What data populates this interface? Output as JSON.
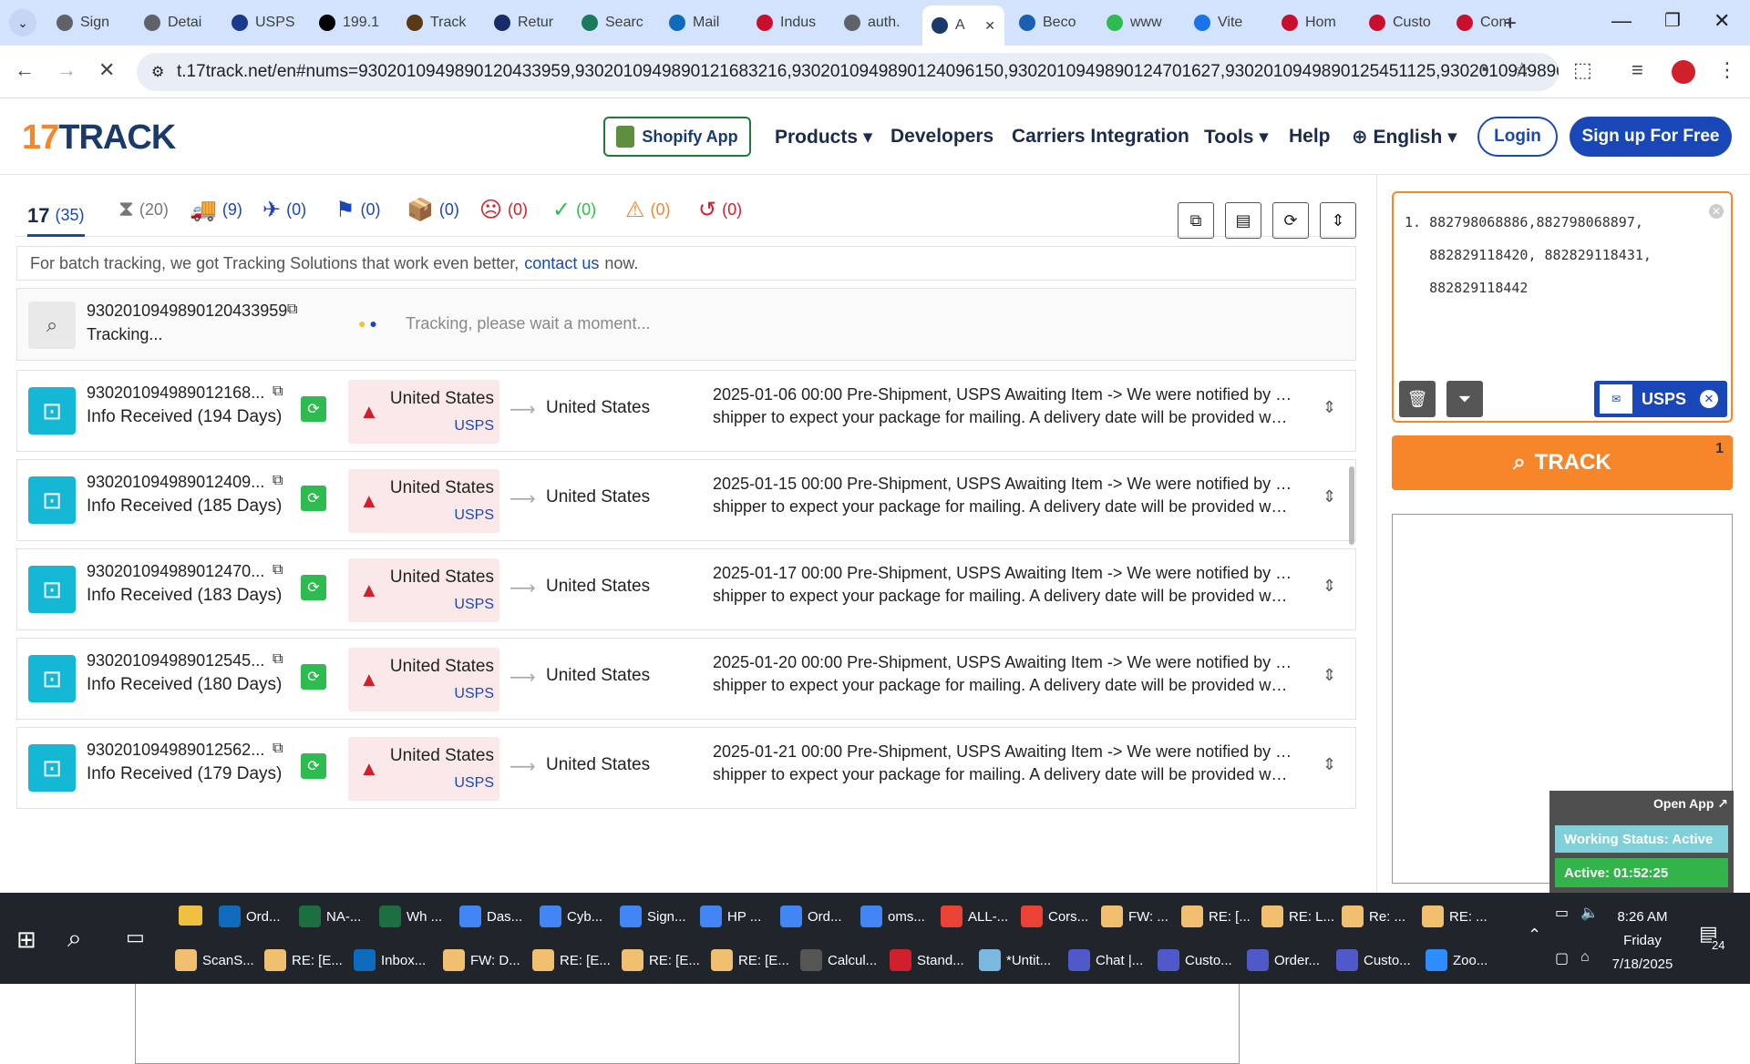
{
  "browser": {
    "tabs": [
      {
        "label": "Sign",
        "color": "#5f6368"
      },
      {
        "label": "Detai",
        "color": "#5f6368"
      },
      {
        "label": "USPS",
        "color": "#1a3a8c"
      },
      {
        "label": "199.1",
        "color": "#000000"
      },
      {
        "label": "Track",
        "color": "#5a3a16"
      },
      {
        "label": "Retur",
        "color": "#1a2b6c"
      },
      {
        "label": "Searc",
        "color": "#1a7a5a"
      },
      {
        "label": "Mail",
        "color": "#0f6cbd"
      },
      {
        "label": "Indus",
        "color": "#c8102e"
      },
      {
        "label": "auth.",
        "color": "#5f6368"
      },
      {
        "label": "A",
        "color": "#1a3a6b",
        "active": true
      },
      {
        "label": "Beco",
        "color": "#1a5fb4"
      },
      {
        "label": "www",
        "color": "#2ebb4f"
      },
      {
        "label": "Vite",
        "color": "#1a73e8"
      },
      {
        "label": "Hom",
        "color": "#c8102e"
      },
      {
        "label": "Custo",
        "color": "#c8102e"
      },
      {
        "label": "Com",
        "color": "#c8102e"
      }
    ],
    "url": "t.17track.net/en#nums=9302010949890120433959,9302010949890121683216,9302010949890124096150,9302010949890124701627,9302010949890125451125,930201094989012..."
  },
  "site": {
    "logo_a": "17",
    "logo_b": "TRACK",
    "shopify": "Shopify App",
    "nav": {
      "products": "Products",
      "developers": "Developers",
      "carriers": "Carriers Integration",
      "tools": "Tools",
      "help": "Help",
      "language": "English"
    },
    "login": "Login",
    "signup": "Sign up For Free"
  },
  "filters": [
    {
      "icon": "17",
      "count": "(35)",
      "color": "#1a47b8"
    },
    {
      "icon": "⧗",
      "count": "(20)",
      "color": "#777"
    },
    {
      "icon": "🚚",
      "count": "(9)",
      "color": "#1a47b8"
    },
    {
      "icon": "✈",
      "count": "(0)",
      "color": "#1a47b8"
    },
    {
      "icon": "⚑",
      "count": "(0)",
      "color": "#1a47b8"
    },
    {
      "icon": "📦",
      "count": "(0)",
      "color": "#1a47b8"
    },
    {
      "icon": "☹",
      "count": "(0)",
      "color": "#d0202c"
    },
    {
      "icon": "✓",
      "count": "(0)",
      "color": "#2ebb4f"
    },
    {
      "icon": "⚠",
      "count": "(0)",
      "color": "#f7862b"
    },
    {
      "icon": "↺",
      "count": "(0)",
      "color": "#d0202c"
    }
  ],
  "banner": {
    "text": "For batch tracking, we got Tracking Solutions that work even better,",
    "link": "contact us",
    "after": "now."
  },
  "pending": {
    "number": "9302010949890120433959",
    "status": "Tracking...",
    "message": "Tracking, please wait a moment..."
  },
  "rows": [
    {
      "number": "930201094989012168...",
      "status": "Info Received (194 Days)",
      "origin": "United States",
      "carrier": "USPS",
      "dest": "United States",
      "event": "2025-01-06 00:00  Pre-Shipment, USPS Awaiting Item -> We were notified by the",
      "event2": "shipper to expect your package for mailing. A delivery date will be provided whe..."
    },
    {
      "number": "930201094989012409...",
      "status": "Info Received (185 Days)",
      "origin": "United States",
      "carrier": "USPS",
      "dest": "United States",
      "event": "2025-01-15 00:00  Pre-Shipment, USPS Awaiting Item -> We were notified by the",
      "event2": "shipper to expect your package for mailing. A delivery date will be provided whe..."
    },
    {
      "number": "930201094989012470...",
      "status": "Info Received (183 Days)",
      "origin": "United States",
      "carrier": "USPS",
      "dest": "United States",
      "event": "2025-01-17 00:00  Pre-Shipment, USPS Awaiting Item -> We were notified by the",
      "event2": "shipper to expect your package for mailing. A delivery date will be provided whe..."
    },
    {
      "number": "930201094989012545...",
      "status": "Info Received (180 Days)",
      "origin": "United States",
      "carrier": "USPS",
      "dest": "United States",
      "event": "2025-01-20 00:00  Pre-Shipment, USPS Awaiting Item -> We were notified by the",
      "event2": "shipper to expect your package for mailing. A delivery date will be provided whe..."
    },
    {
      "number": "930201094989012562...",
      "status": "Info Received (179 Days)",
      "origin": "United States",
      "carrier": "USPS",
      "dest": "United States",
      "event": "2025-01-21 00:00  Pre-Shipment, USPS Awaiting Item -> We were notified by the",
      "event2": "shipper to expect your package for mailing. A delivery date will be provided whe..."
    }
  ],
  "input": {
    "lines": [
      "1. 882798068886,882798068897,",
      "   882829118420, 882829118431,",
      "   882829118442"
    ],
    "carrier": "USPS",
    "track": "TRACK",
    "count": "1"
  },
  "widget": {
    "open": "Open App ↗",
    "status": "Working Status: Active",
    "active": "Active: 01:52:25"
  },
  "taskbar": {
    "row1": [
      {
        "label": "Ord...",
        "color": "#0f6cbd"
      },
      {
        "label": "NA-...",
        "color": "#1d6f42"
      },
      {
        "label": "Wh ...",
        "color": "#1d6f42"
      },
      {
        "label": "Das...",
        "color": "#4285f4"
      },
      {
        "label": "Cyb...",
        "color": "#4285f4"
      },
      {
        "label": "Sign...",
        "color": "#4285f4"
      },
      {
        "label": "HP ...",
        "color": "#4285f4"
      },
      {
        "label": "Ord...",
        "color": "#4285f4"
      },
      {
        "label": "oms...",
        "color": "#4285f4"
      },
      {
        "label": "ALL-...",
        "color": "#ea4335"
      },
      {
        "label": "Cors...",
        "color": "#ea4335"
      },
      {
        "label": "FW: ...",
        "color": "#f0c070"
      },
      {
        "label": "RE: [...",
        "color": "#f0c070"
      },
      {
        "label": "RE: L...",
        "color": "#f0c070"
      },
      {
        "label": "Re: ...",
        "color": "#f0c070"
      },
      {
        "label": "RE: ...",
        "color": "#f0c070"
      }
    ],
    "row2": [
      {
        "label": "ScanS...",
        "color": "#f0c070"
      },
      {
        "label": "RE: [E...",
        "color": "#f0c070"
      },
      {
        "label": "Inbox...",
        "color": "#0f6cbd"
      },
      {
        "label": "FW: D...",
        "color": "#f0c070"
      },
      {
        "label": "RE: [E...",
        "color": "#f0c070"
      },
      {
        "label": "RE: [E...",
        "color": "#f0c070"
      },
      {
        "label": "RE: [E...",
        "color": "#f0c070"
      },
      {
        "label": "Calcul...",
        "color": "#555555"
      },
      {
        "label": "Stand...",
        "color": "#d0202c"
      },
      {
        "label": "*Untit...",
        "color": "#7ab8e0"
      },
      {
        "label": "Chat |...",
        "color": "#5059c9"
      },
      {
        "label": "Custo...",
        "color": "#5059c9"
      },
      {
        "label": "Order...",
        "color": "#5059c9"
      },
      {
        "label": "Custo...",
        "color": "#5059c9"
      },
      {
        "label": "Zoo...",
        "color": "#2d8cff"
      }
    ],
    "time": "8:26 AM",
    "day": "Friday",
    "date": "7/18/2025",
    "notif": "24"
  }
}
